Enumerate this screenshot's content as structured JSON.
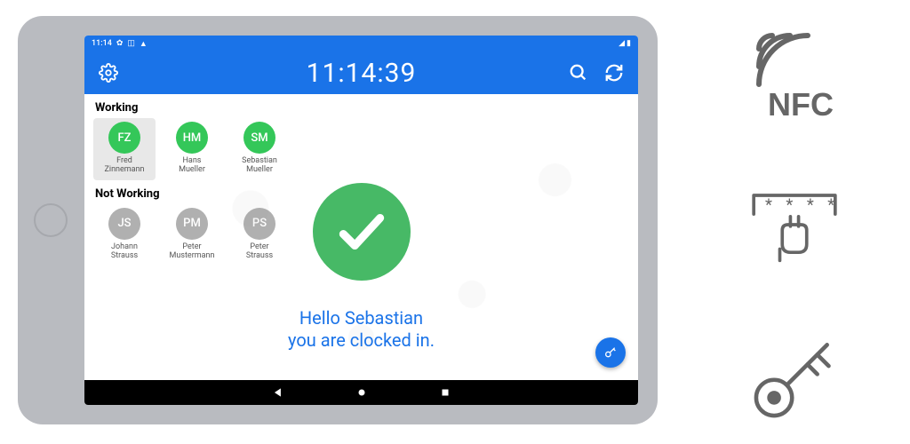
{
  "statusBar": {
    "time": "11:14"
  },
  "appBar": {
    "clock": "11:14:39"
  },
  "sections": {
    "working": {
      "title": "Working",
      "users": [
        {
          "initials": "FZ",
          "name": "Fred\nZinnemann",
          "selected": true
        },
        {
          "initials": "HM",
          "name": "Hans\nMueller",
          "selected": false
        },
        {
          "initials": "SM",
          "name": "Sebastian\nMueller",
          "selected": false
        }
      ]
    },
    "notWorking": {
      "title": "Not Working",
      "users": [
        {
          "initials": "JS",
          "name": "Johann\nStrauss"
        },
        {
          "initials": "PM",
          "name": "Peter\nMustermann"
        },
        {
          "initials": "PS",
          "name": "Peter\nStrauss"
        }
      ]
    }
  },
  "greeting": {
    "line1": "Hello Sebastian",
    "line2": "you are clocked in."
  },
  "sideLabels": {
    "nfc": "NFC"
  },
  "colors": {
    "primary": "#1a73e8",
    "success": "#47b966",
    "grey": "#b0b0b0"
  }
}
